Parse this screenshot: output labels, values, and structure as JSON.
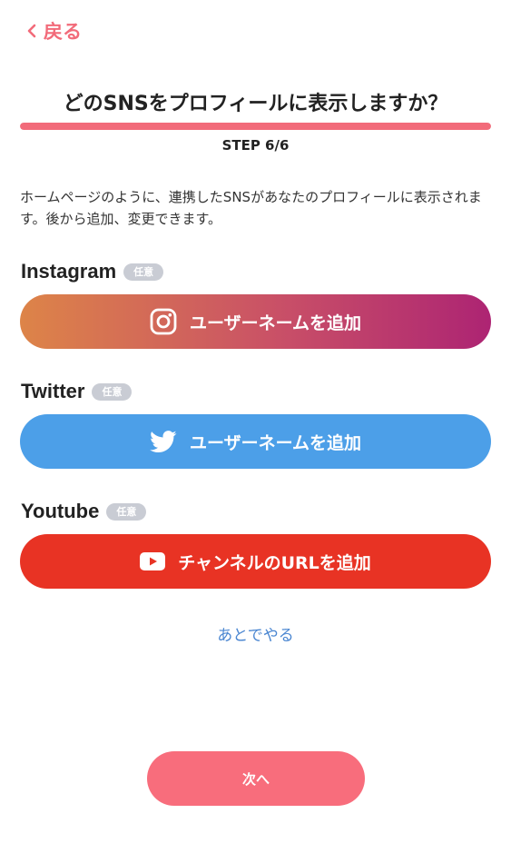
{
  "header": {
    "back_label": "戻る"
  },
  "onboarding": {
    "title": "どのSNSをプロフィールに表示しますか？",
    "step_label": "STEP 6/6",
    "progress": 1.0,
    "description": "ホームページのように、連携したSNSがあなたのプロフィールに表示されます。後から追加、変更できます。"
  },
  "sns": {
    "instagram": {
      "name": "Instagram",
      "badge": "任意",
      "button_label": "ユーザーネームを追加",
      "icon": "instagram-icon"
    },
    "twitter": {
      "name": "Twitter",
      "badge": "任意",
      "button_label": "ユーザーネームを追加",
      "icon": "twitter-bird-icon"
    },
    "youtube": {
      "name": "Youtube",
      "badge": "任意",
      "button_label": "チャンネルのURLを追加",
      "icon": "youtube-play-icon"
    }
  },
  "actions": {
    "later_label": "あとでやる",
    "next_label": "次へ"
  },
  "colors": {
    "accent": "#f26b7a",
    "instagram_start": "#dd8448",
    "instagram_end": "#ad2473",
    "twitter": "#4c9fe8",
    "youtube": "#e83324",
    "link": "#4a86d1",
    "badge": "#c9ccd4"
  }
}
